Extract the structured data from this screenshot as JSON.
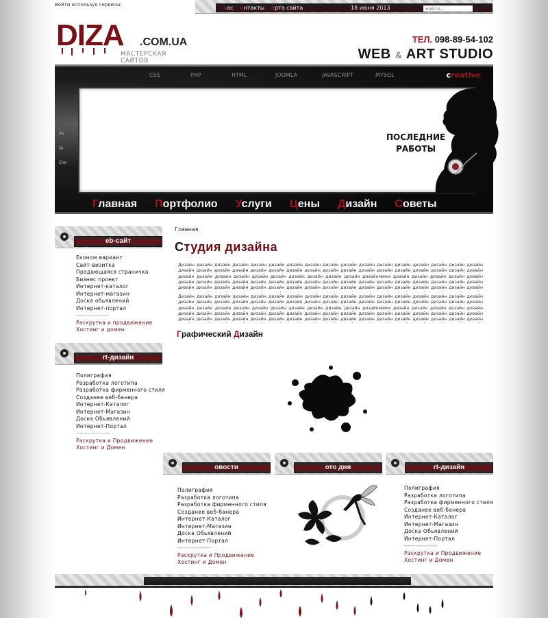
{
  "top": {
    "login_text": "Войти используя сервисы:",
    "nav": [
      "нас",
      "онтакты",
      "арта сайта"
    ],
    "date": "18 июня 2013",
    "search_placeholder": "найти..."
  },
  "logo": {
    "main_dark": "DIZA",
    "domain": ".COM.UA",
    "subtitle": "МАСТЕРСКАЯ САЙТОВ"
  },
  "contact": {
    "phone_prefix": "ТЕЛ.",
    "phone": "098-89-54-102",
    "studio_left": "WEB",
    "studio_amp": "&",
    "studio_right": "ART STUDIO"
  },
  "banner": {
    "tech": [
      "CSS",
      "PHP",
      "HTML",
      "JOOMLA",
      "JAVASCRIPT",
      "MYSQL"
    ],
    "creative_red": "c",
    "creative_rest": "reative",
    "side_tools": [
      "Ps",
      "Ai",
      "Dw"
    ],
    "latest_line1": "ПОСЛЕДНИЕ",
    "latest_line2": "РАБОТЫ",
    "nav": [
      "Главная",
      "Портфолио",
      "Услуги",
      "Цены",
      "Дизайн",
      "Советы"
    ]
  },
  "sidebar": {
    "web": {
      "title": "eb-сайт",
      "items": [
        "Економ вариант",
        "Сайт-визитка",
        "Продающаяся страничка",
        "Бизнес проект",
        "Интернет-каталог",
        "Интернет-магазин",
        "Доска обьявлений",
        "Интернет-портал"
      ],
      "separator": "------------------",
      "extra": [
        "Раскрутка и продвижение",
        "Хостинг и домен"
      ]
    },
    "art": {
      "title": "rt-дизайн",
      "items": [
        "Полиграфия",
        "Разработка логотипа",
        "Разработка фирменного стиля",
        "Созданее веб-банера",
        "Интернет-Каталог",
        "Интернет-Магазин",
        "Доска Обьявлений",
        "Интернет-Портал"
      ],
      "separator": "------------------",
      "extra": [
        "Раскрутка и Продвижение",
        "Хостинг и Домен"
      ]
    }
  },
  "content": {
    "breadcrumb": "Главная",
    "title": "Студия дизайна",
    "paragraph1": "Дизайн дизайн дизайн дизайн дизайн дизайн дизайн дизайн дизайн дизайн дизайн дизайн дизайн дизайн дизайн дизайн дизайн дизайн дизайн дизайн дизайн дизайн дизайн дизайн дизайн дизайн дизайн дизайн дизайн дизайн дизайн дизайн дизайн дизайн дизайн дизайн дизайн дизайн дизайн дизайн дизайн дизайн дизайн дизайн дизайнмимм дизайн дизайн дизайн дизайн дизайн дизайн дизайн дизайн дизайн дизайн дизайн дизайн дизайн дизайн дизайн дизайн дизайн дизайн дизайн дизайн дизайн дизайн дизайн дизайн дизайн дизайн дизайн дизайн дизайн дизайн дизайн дизайн дизайн дизайн дизайн дизайн дизайн дизайн дизайн дизайн дизайн дизайн дизайн дизайн дизайн дизайн дизайн дизайн дизайн дизайн дизайн дизайн дизайн дизайн дизайн дизайн дизайн дизайн дизайн дизайн дизайн дизайн дизайн дизайндизайн",
    "paragraph2": "Дизайн дизайн дизайн дизайн дизайн дизайн дизайн дизайн дизайн дизайн дизайн дизайн дизайн дизайн дизайн дизайн дизайн дизайн дизайн дизайн дизайн дизайн дизайн дизайн дизайн дизайн дизайн дизайн дизайн дизайн дизайн дизайн дизайн дизайн дизайн дизайн дизайн дизайн дизайн дизайн дизайн дизайн дизайн дизайн дизайнмимм дизайн дизайн дизайн дизайн дизайн дизайн дизайн дизайн дизайн дизайн дизайн дизайн дизайн дизайн дизайн дизайн дизайн дизайн дизайн дизайн дизайн дизайн дизайн дизайн дизайн дизайн дизайн дизайн дизайн дизайн дизайн дизайн дизайн дизайн дизайн дизайн дизайн дизайн дизайн дизайн дизайн дизайн дизайн дизайн дизайн дизайн дизайн дизайн дизайн дизайн дизайн дизайн дизайн дизайн дизайн дизайн дизайн дизайн дизайн дизайн дизайн дизайн дизайн дизайн дизайндизайн",
    "subtitle_red": "Г",
    "subtitle_rest": "рафический ",
    "subtitle_red2": "Д",
    "subtitle_rest2": "изайн"
  },
  "bottom": {
    "news": {
      "title": "овости",
      "items": [
        "Полиграфия",
        "Разработка логотипа",
        "Разработка фирменного стиля",
        "Созданее веб-банера",
        "Интернет-Каталог",
        "Интернет-Магазин",
        "Доска Обьявлений",
        "Интернет-Портал"
      ],
      "separator": "------------------",
      "extra": [
        "Раскрутка и Продвижение",
        "Хостинг и Домен"
      ]
    },
    "photo": {
      "title": "ото дня"
    },
    "art": {
      "title": "rt-дизайн",
      "items": [
        "Полиграфия",
        "Разработка логотипа",
        "Разработка фирменного стиля",
        "Созданее веб-банера",
        "Интернет-Каталог",
        "Интернет-Магазин",
        "Доска Обьявлений",
        "Интернет-Портал"
      ],
      "separator": "------------------",
      "extra": [
        "Раскрутка и Продвижение",
        "Хостинг и Домен"
      ]
    }
  },
  "colors": {
    "accent_red": "#7a0f15",
    "dark": "#111111",
    "banner_bg": "#0f0f0f"
  }
}
